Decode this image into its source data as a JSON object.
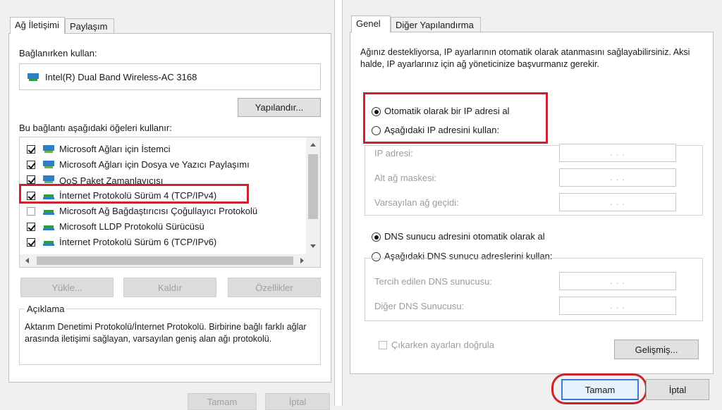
{
  "left": {
    "tabs": [
      "Ağ İletişimi",
      "Paylaşım"
    ],
    "connect_using_label": "Bağlanırken kullan:",
    "adapter_name": "Intel(R) Dual Band Wireless-AC 3168",
    "configure_button": "Yapılandır...",
    "items_label": "Bu bağlantı aşağıdaki öğeleri kullanır:",
    "items": [
      {
        "label": "Microsoft Ağları için İstemci",
        "checked": true
      },
      {
        "label": "Microsoft Ağları için Dosya ve Yazıcı Paylaşımı",
        "checked": true
      },
      {
        "label": "QoS Paket Zamanlayıcısı",
        "checked": true
      },
      {
        "label": "İnternet Protokolü Sürüm 4 (TCP/IPv4)",
        "checked": true
      },
      {
        "label": "Microsoft Ağ Bağdaştırıcısı Çoğullayıcı Protokolü",
        "checked": false
      },
      {
        "label": "Microsoft LLDP Protokolü Sürücüsü",
        "checked": true
      },
      {
        "label": "İnternet Protokolü Sürüm 6 (TCP/IPv6)",
        "checked": true
      }
    ],
    "install_button": "Yükle...",
    "uninstall_button": "Kaldır",
    "properties_button": "Özellikler",
    "description_title": "Açıklama",
    "description_text": "Aktarım Denetimi Protokolü/İnternet Protokolü. Birbirine bağlı farklı ağlar arasında iletişimi sağlayan, varsayılan geniş alan ağı protokolü.",
    "ok_button": "Tamam",
    "cancel_button": "İptal"
  },
  "right": {
    "tabs": [
      "Genel",
      "Diğer Yapılandırma"
    ],
    "intro_text": "Ağınız destekliyorsa, IP ayarlarının otomatik olarak atanmasını sağlayabilirsiniz. Aksi halde, IP ayarlarınız için ağ yöneticinize başvurmanız gerekir.",
    "radio_auto_ip": "Otomatik olarak bir IP adresi al",
    "radio_manual_ip": "Aşağıdaki IP adresini kullan:",
    "ip_address_label": "IP adresi:",
    "subnet_label": "Alt ağ maskesi:",
    "gateway_label": "Varsayılan ağ geçidi:",
    "radio_auto_dns": "DNS sunucu adresini otomatik olarak al",
    "radio_manual_dns": "Aşağıdaki DNS sunucu adreslerini kullan:",
    "preferred_dns_label": "Tercih edilen DNS sunucusu:",
    "alternate_dns_label": "Diğer DNS Sunucusu:",
    "ip_placeholder": ".   .   .",
    "validate_label": "Çıkarken ayarları doğrula",
    "advanced_button": "Gelişmiş...",
    "ok_button": "Tamam",
    "cancel_button": "İptal"
  },
  "colors": {
    "highlight_red": "#c9232e",
    "network_icon_green": "#2f9e3a",
    "network_icon_blue": "#2d7fc9"
  }
}
